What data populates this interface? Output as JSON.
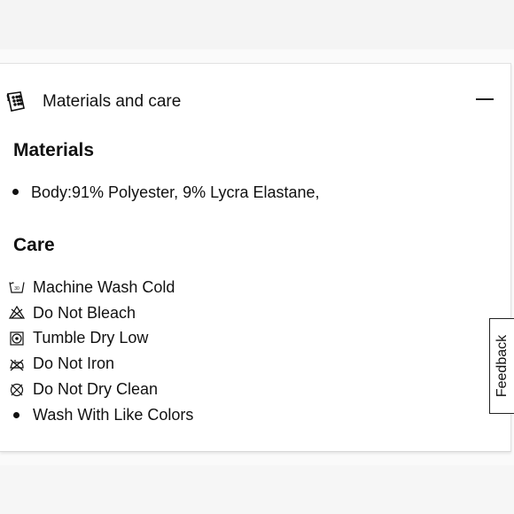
{
  "accordion": {
    "title": "Materials and care",
    "icon": "fabric-swatch-icon",
    "expanded": true
  },
  "materials": {
    "heading": "Materials",
    "items": [
      "Body:91% Polyester, 9% Lycra Elastane,"
    ]
  },
  "care": {
    "heading": "Care",
    "items": [
      {
        "icon": "machine-wash-cold-icon",
        "label": "Machine Wash Cold"
      },
      {
        "icon": "do-not-bleach-icon",
        "label": "Do Not Bleach"
      },
      {
        "icon": "tumble-dry-low-icon",
        "label": "Tumble Dry Low"
      },
      {
        "icon": "do-not-iron-icon",
        "label": "Do Not Iron"
      },
      {
        "icon": "do-not-dry-clean-icon",
        "label": "Do Not Dry Clean"
      },
      {
        "icon": "bullet",
        "label": "Wash With Like Colors"
      }
    ]
  },
  "feedback": {
    "label": "Feedback"
  }
}
